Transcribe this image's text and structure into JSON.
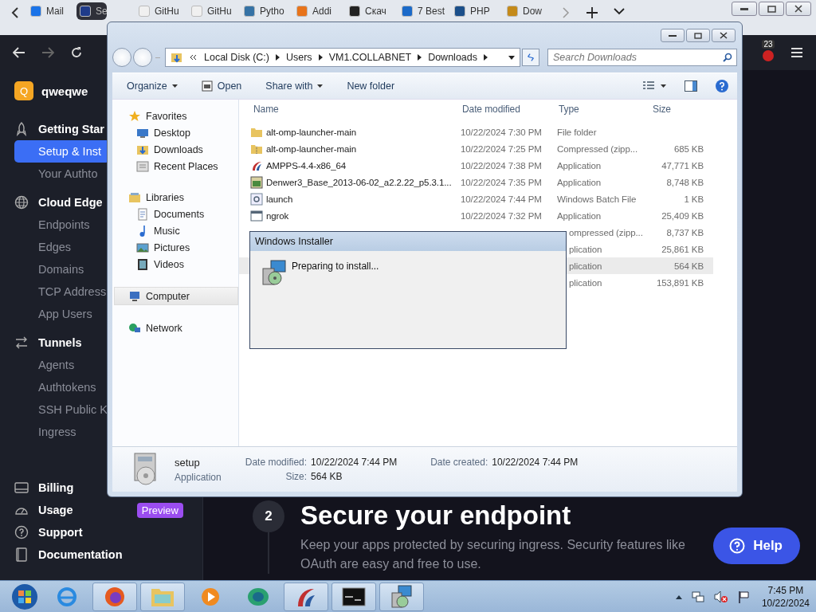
{
  "browser": {
    "tabs": [
      {
        "label": "Mail",
        "selected": false
      },
      {
        "label": "Se",
        "selected": true
      },
      {
        "label": "GitHu",
        "selected": false
      },
      {
        "label": "GitHu",
        "selected": false
      },
      {
        "label": "Pytho",
        "selected": false
      },
      {
        "label": "Addi",
        "selected": false
      },
      {
        "label": "Скач",
        "selected": false
      },
      {
        "label": "7 Best",
        "selected": false
      },
      {
        "label": "PHP",
        "selected": false
      },
      {
        "label": "Dow",
        "selected": false
      }
    ],
    "notification_count": "23"
  },
  "sidebar": {
    "account": {
      "initial": "Q",
      "name": "qweqwe"
    },
    "sections": [
      {
        "label": "Getting Star",
        "items": [
          {
            "label": "Setup & Inst",
            "selected": true
          },
          {
            "label": "Your Authto",
            "selected": false
          }
        ]
      },
      {
        "label": "Cloud Edge",
        "items": [
          {
            "label": "Endpoints",
            "selected": false
          },
          {
            "label": "Edges",
            "selected": false
          },
          {
            "label": "Domains",
            "selected": false
          },
          {
            "label": "TCP Address",
            "selected": false
          },
          {
            "label": "App Users",
            "selected": false
          }
        ]
      },
      {
        "label": "Tunnels",
        "items": [
          {
            "label": "Agents",
            "selected": false
          },
          {
            "label": "Authtokens",
            "selected": false
          },
          {
            "label": "SSH Public K",
            "selected": false
          },
          {
            "label": "Ingress",
            "selected": false
          }
        ]
      }
    ],
    "bottom_links": [
      {
        "label": "Billing"
      },
      {
        "label": "Usage",
        "badge": "Preview"
      },
      {
        "label": "Support"
      },
      {
        "label": "Documentation"
      }
    ]
  },
  "main": {
    "step": "2",
    "title": "Secure your endpoint",
    "text": "Keep your apps protected by securing ingress. Security features like OAuth are easy and free to use.",
    "help_button": "Help"
  },
  "explorer": {
    "breadcrumb": [
      "Local Disk (C:)",
      "Users",
      "VM1.COLLABNET",
      "Downloads"
    ],
    "search": {
      "placeholder": "Search Downloads"
    },
    "toolbar": [
      {
        "label": "Organize",
        "dropdown": true
      },
      {
        "label": "Open",
        "dropdown": false
      },
      {
        "label": "Share with",
        "dropdown": true
      },
      {
        "label": "New folder",
        "dropdown": false
      }
    ],
    "nav": [
      {
        "label": "Favorites",
        "kind": "star",
        "selected": false,
        "children": [
          {
            "label": "Desktop",
            "kind": "desktop"
          },
          {
            "label": "Downloads",
            "kind": "downloads"
          },
          {
            "label": "Recent Places",
            "kind": "recent"
          }
        ]
      },
      {
        "label": "Libraries",
        "kind": "library",
        "selected": false,
        "children": [
          {
            "label": "Documents",
            "kind": "documents"
          },
          {
            "label": "Music",
            "kind": "music"
          },
          {
            "label": "Pictures",
            "kind": "pictures"
          },
          {
            "label": "Videos",
            "kind": "videos"
          }
        ]
      },
      {
        "label": "Computer",
        "kind": "computer",
        "selected": true
      },
      {
        "label": "Network",
        "kind": "network",
        "selected": false
      }
    ],
    "columns": [
      "Name",
      "Date modified",
      "Type",
      "Size"
    ],
    "rows": [
      {
        "name": "alt-omp-launcher-main",
        "kind": "folder",
        "date": "10/22/2024 7:30 PM",
        "type": "File folder",
        "selected": false
      },
      {
        "name": "alt-omp-launcher-main",
        "kind": "zip",
        "date": "10/22/2024 7:25 PM",
        "type": "Compressed (zipp...",
        "size": "685 KB",
        "selected": false
      },
      {
        "name": "AMPPS-4.4-x86_64",
        "kind": "ampps",
        "date": "10/22/2024 7:38 PM",
        "type": "Application",
        "size": "47,771 KB",
        "selected": false
      },
      {
        "name": "Denwer3_Base_2013-06-02_a2.2.22_p5.3.1...",
        "kind": "installer",
        "date": "10/22/2024 7:35 PM",
        "type": "Application",
        "size": "8,748 KB",
        "selected": false
      },
      {
        "name": "launch",
        "kind": "batch",
        "date": "10/22/2024 7:44 PM",
        "type": "Windows Batch File",
        "size": "1 KB",
        "selected": false
      },
      {
        "name": "ngrok",
        "kind": "app",
        "date": "10/22/2024 7:32 PM",
        "type": "Application",
        "size": "25,409 KB",
        "selected": false
      },
      {
        "type": "ompressed (zipp...",
        "size": "8,737 KB",
        "selected": false
      },
      {
        "type": "plication",
        "size": "25,861 KB",
        "selected": false
      },
      {
        "type": "plication",
        "size": "564 KB",
        "selected": true
      },
      {
        "type": "plication",
        "size": "153,891 KB",
        "selected": false
      }
    ],
    "details": {
      "name": "setup",
      "type": "Application",
      "modified_label": "Date modified:",
      "modified": "10/22/2024 7:44 PM",
      "created_label": "Date created:",
      "created": "10/22/2024 7:44 PM",
      "size_label": "Size:",
      "size": "564 KB"
    }
  },
  "installer": {
    "title": "Windows Installer",
    "message": "Preparing to install..."
  },
  "taskbar": {
    "time": "7:45 PM",
    "date": "10/22/2024"
  }
}
